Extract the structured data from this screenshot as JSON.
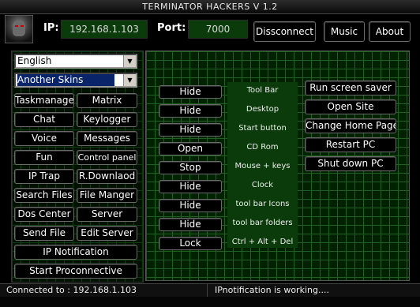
{
  "window": {
    "title": "TERMINATOR HACKERS V 1.2"
  },
  "connection": {
    "ip_label": "IP:",
    "ip_value": "192.168.1.103",
    "port_label": "Port:",
    "port_value": "7000",
    "disconnect_label": "Dissconnect",
    "music_label": "Music",
    "about_label": "About"
  },
  "selects": {
    "language": "English",
    "skin": "Another Skins"
  },
  "left_buttons": {
    "taskmanager": "Taskmanager",
    "matrix": "Matrix",
    "chat": "Chat",
    "keylogger": "Keylogger",
    "voice": "Voice",
    "messages": "Messages",
    "fun": "Fun",
    "control_panel": "Control panel",
    "ip_trap": "IP Trap",
    "r_download": "R.Downlaod",
    "search_files": "Search Files",
    "file_manager": "File Manger",
    "dos_center": "Dos Center",
    "server": "Server",
    "send_file": "Send File",
    "edit_server": "Edit Server",
    "ip_notification": "IP Notification",
    "start_proconnective": "Start Proconnective"
  },
  "actions": [
    {
      "button": "Hide",
      "target": "Tool Bar"
    },
    {
      "button": "Hide",
      "target": "Desktop"
    },
    {
      "button": "Hide",
      "target": "Start button"
    },
    {
      "button": "Open",
      "target": "CD Rom"
    },
    {
      "button": "Stop",
      "target": "Mouse + keys"
    },
    {
      "button": "Hide",
      "target": "Clock"
    },
    {
      "button": "Hide",
      "target": "tool bar Icons"
    },
    {
      "button": "Hide",
      "target": "tool bar folders"
    },
    {
      "button": "Lock",
      "target": "Ctrl + Alt + Del"
    }
  ],
  "right_buttons": {
    "screen_saver": "Run screen saver",
    "open_site": "Open Site",
    "home_page": "Change Home Page",
    "restart": "Restart PC",
    "shutdown": "Shut down PC"
  },
  "status": {
    "connected": "Connected to : 192.168.1.103",
    "notification": "IPnotification is working...."
  },
  "colors": {
    "panel_green": "#0b3b0b",
    "grid_line": "#1f5f1f",
    "selection": "#0a246a"
  }
}
